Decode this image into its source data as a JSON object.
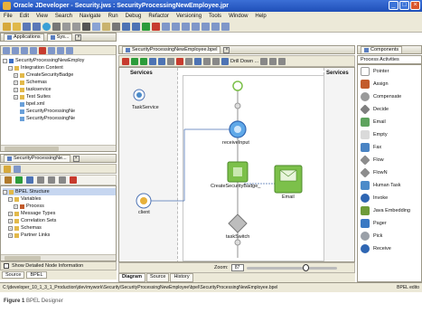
{
  "window": {
    "title": "Oracle JDeveloper - Security.jws : SecurityProcessingNewEmployee.jpr"
  },
  "menu": [
    "File",
    "Edit",
    "View",
    "Search",
    "Navigate",
    "Run",
    "Debug",
    "Refactor",
    "Versioning",
    "Tools",
    "Window",
    "Help"
  ],
  "left_panel": {
    "tabs": [
      "Applications",
      "Sys..."
    ],
    "tree": [
      {
        "label": "SecurityProcessingNewEmploy",
        "level": 0,
        "expander": "-",
        "icon": "project"
      },
      {
        "label": "Integration Content",
        "level": 1,
        "expander": "-",
        "icon": "folder"
      },
      {
        "label": "CreateSecurityBadge",
        "level": 2,
        "expander": "+",
        "icon": "folder"
      },
      {
        "label": "Schemas",
        "level": 2,
        "expander": "+",
        "icon": "folder"
      },
      {
        "label": "taskservice",
        "level": 2,
        "expander": "+",
        "icon": "folder"
      },
      {
        "label": "Test Suites",
        "level": 2,
        "expander": "+",
        "icon": "folder"
      },
      {
        "label": "bpel.xml",
        "level": 2,
        "expander": "",
        "icon": "file"
      },
      {
        "label": "SecurityProcessingNe",
        "level": 2,
        "expander": "",
        "icon": "file"
      },
      {
        "label": "SecurityProcessingNe",
        "level": 2,
        "expander": "",
        "icon": "file"
      }
    ]
  },
  "structure_panel": {
    "header": "SecurityProcessingNe...",
    "tree": [
      {
        "label": "BPEL Structure",
        "level": 0,
        "expander": "-",
        "selected": true
      },
      {
        "label": "Variables",
        "level": 1,
        "expander": "-"
      },
      {
        "label": "Process",
        "level": 2,
        "expander": "+"
      },
      {
        "label": "Message Types",
        "level": 1,
        "expander": "+"
      },
      {
        "label": "Correlation Sets",
        "level": 1,
        "expander": "+"
      },
      {
        "label": "Schemas",
        "level": 1,
        "expander": "+"
      },
      {
        "label": "Partner Links",
        "level": 1,
        "expander": "+"
      }
    ],
    "checkbox_label": "Show Detailed Node Information",
    "tabs": [
      "Source",
      "BPEL"
    ]
  },
  "editor": {
    "tab": "SecurityProcessingNewEmployee.bpel",
    "toolbar_label": "Drill Down ...",
    "lanes": {
      "left": "Services",
      "right": "Services"
    },
    "nodes": {
      "task_service": "TaskService",
      "receive": "receiveInput",
      "create_badge": "CreateSecurityBadge_",
      "email": "Email",
      "client": "client",
      "task_switch": "taskSwitch"
    },
    "zoom_label": "Zoom:",
    "zoom_value": "87",
    "tabs": [
      "Diagram",
      "Source",
      "History"
    ]
  },
  "palette": {
    "header": "Components",
    "category": "Process Activities",
    "items": [
      {
        "label": "Pointer",
        "color": "#ffffff"
      },
      {
        "label": "Assign",
        "color": "#c25b2c"
      },
      {
        "label": "Compensate",
        "color": "#9a9a9a"
      },
      {
        "label": "Decide",
        "color": "#7f7f7f"
      },
      {
        "label": "Email",
        "color": "#5ea35e"
      },
      {
        "label": "Empty",
        "color": "#dadada"
      },
      {
        "label": "Fax",
        "color": "#4a84c4"
      },
      {
        "label": "Flow",
        "color": "#8d8d8d"
      },
      {
        "label": "FlowN",
        "color": "#8d8d8d"
      },
      {
        "label": "Human Task",
        "color": "#4c8bc9"
      },
      {
        "label": "Invoke",
        "color": "#2f66b3"
      },
      {
        "label": "Java Embedding",
        "color": "#6e9c3a"
      },
      {
        "label": "Pager",
        "color": "#3a79c3"
      },
      {
        "label": "Pick",
        "color": "#9aa0a8"
      },
      {
        "label": "Receive",
        "color": "#2f66b3"
      }
    ]
  },
  "status": {
    "path": "C:\\jdeveloper_10_1_3_1_Production\\jdev\\mywork\\Security\\SecurityProcessingNewEmployee\\bpel\\SecurityProcessingNewEmployee.bpel",
    "right": "BPEL edito"
  },
  "caption": {
    "label": "Figure 1",
    "text": "BPEL Designer"
  },
  "colors": {
    "titlebar": "#2456c4",
    "selection": "#c6d6f0",
    "receive_node": "#5fa8e8",
    "green_node": "#7cc04a"
  }
}
